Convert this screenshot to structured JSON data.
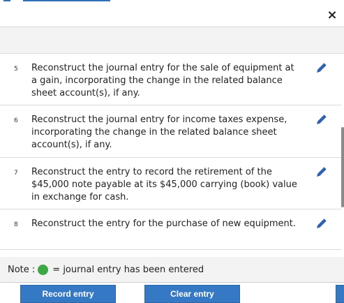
{
  "dialog": {
    "close_glyph": "×"
  },
  "tasks": [
    {
      "number": "5",
      "text": "Reconstruct the journal entry for the sale of equipment at a gain, incorporating the change in the related balance sheet account(s), if any."
    },
    {
      "number": "6",
      "text": "Reconstruct the journal entry for income taxes expense, incorporating the change in the related balance sheet account(s), if any."
    },
    {
      "number": "7",
      "text": "Reconstruct the entry to record the retirement of the $45,000 note payable at its $45,000 carrying (book) value in exchange for cash."
    },
    {
      "number": "8",
      "text": "Reconstruct the entry for the purchase of new equipment."
    }
  ],
  "note": {
    "label": "Note :",
    "legend": "= journal entry has been entered",
    "dot_color": "#3da844"
  },
  "buttons": {
    "record": "Record entry",
    "clear": "Clear entry"
  },
  "colors": {
    "accent": "#3578c4",
    "edit_icon": "#2f62b0"
  }
}
